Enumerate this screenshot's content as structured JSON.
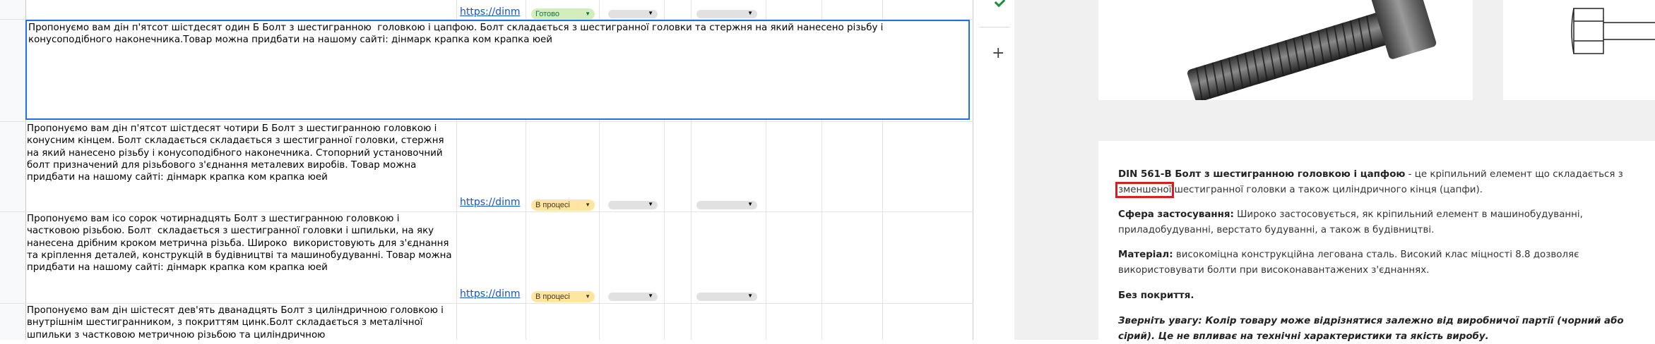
{
  "spreadsheet": {
    "rows": [
      {
        "text": "",
        "link": "https://dinm",
        "status": "Готово",
        "status_type": "done"
      },
      {
        "text": "Пропонуємо вам дін п'ятсот шістдесят один Б Болт з шестигранною  головкою і цапфою. Болт складається з шестигранної головки та стержня на який нанесено різьбу і конусоподібного наконечника.Товар можна придбати на нашому сайті: дінмарк крапка ком крапка юей",
        "link": "",
        "status": "",
        "status_type": "editing"
      },
      {
        "text": "Пропонуємо вам дін п'ятсот шістдесят чотири Б Болт з шестигранною головкою і конусним кінцем. Болт складається складається з шестигранної головки, стержня на який нанесено різьбу і конусоподібного наконечника. Стопорний установочний болт призначений для різьбового з'єднання металевих виробів. Товар можна придбати на нашому сайті: дінмарк крапка ком крапка юей",
        "link": "https://dinm",
        "status": "В процесі",
        "status_type": "progress"
      },
      {
        "text": "Пропонуємо вам ісо сорок чотирнадцять Болт з шестигранною головкою і частковою різьбою. Болт  складається з шестигранної головки і шпильки, на яку нанесена дрібним кроком метрична різьба. Широко  використовують для з'єднання та кріплення деталей, конструкцій в будівництві та машинобудуванні. Товар можна придбати на нашому сайті: дінмарк крапка ком крапка юей",
        "link": "https://dinm",
        "status": "В процесі",
        "status_type": "progress"
      },
      {
        "text": "Пропонуємо вам дін шістесят дев'ять дванадцять Болт з циліндричною головкою і внутрішнім шестигранником, з покриттям цинк.Болт складається з металічної шпильки з частковою метричною різьбою та циліндричною",
        "link": "",
        "status": "",
        "status_type": "none"
      }
    ]
  },
  "gutter": {
    "plus_label": "+"
  },
  "product": {
    "intro_bold": "DIN 561-B Болт з шестигранною головкою і цапфою",
    "intro_pre": " - це кріпильний елемент що складається з ",
    "intro_highlight": "зменшеної",
    "intro_post": " шестигранної головки а також циліндричного кінця (цапфи).",
    "scope_label": "Сфера застосування:",
    "scope_text": " Широко застосовується, як кріпильний елемент в машинобудуванні, приладобудуванні, верстато будуванні, а також в будівництві.",
    "material_label": "Матеріал:",
    "material_text": " високоміцна конструкційна легована сталь. Високий клас міцності 8.8 дозволяє використовувати болти при високонавантажених з'єднаннях.",
    "coating": "Без покриття.",
    "note": "Зверніть увагу: Колір товару може відрізнятися залежно від виробничої партії (чорний або сірий). Це не впливає на технічні характеристики та якість виробу.",
    "highlight_color": "#d61f1f"
  }
}
